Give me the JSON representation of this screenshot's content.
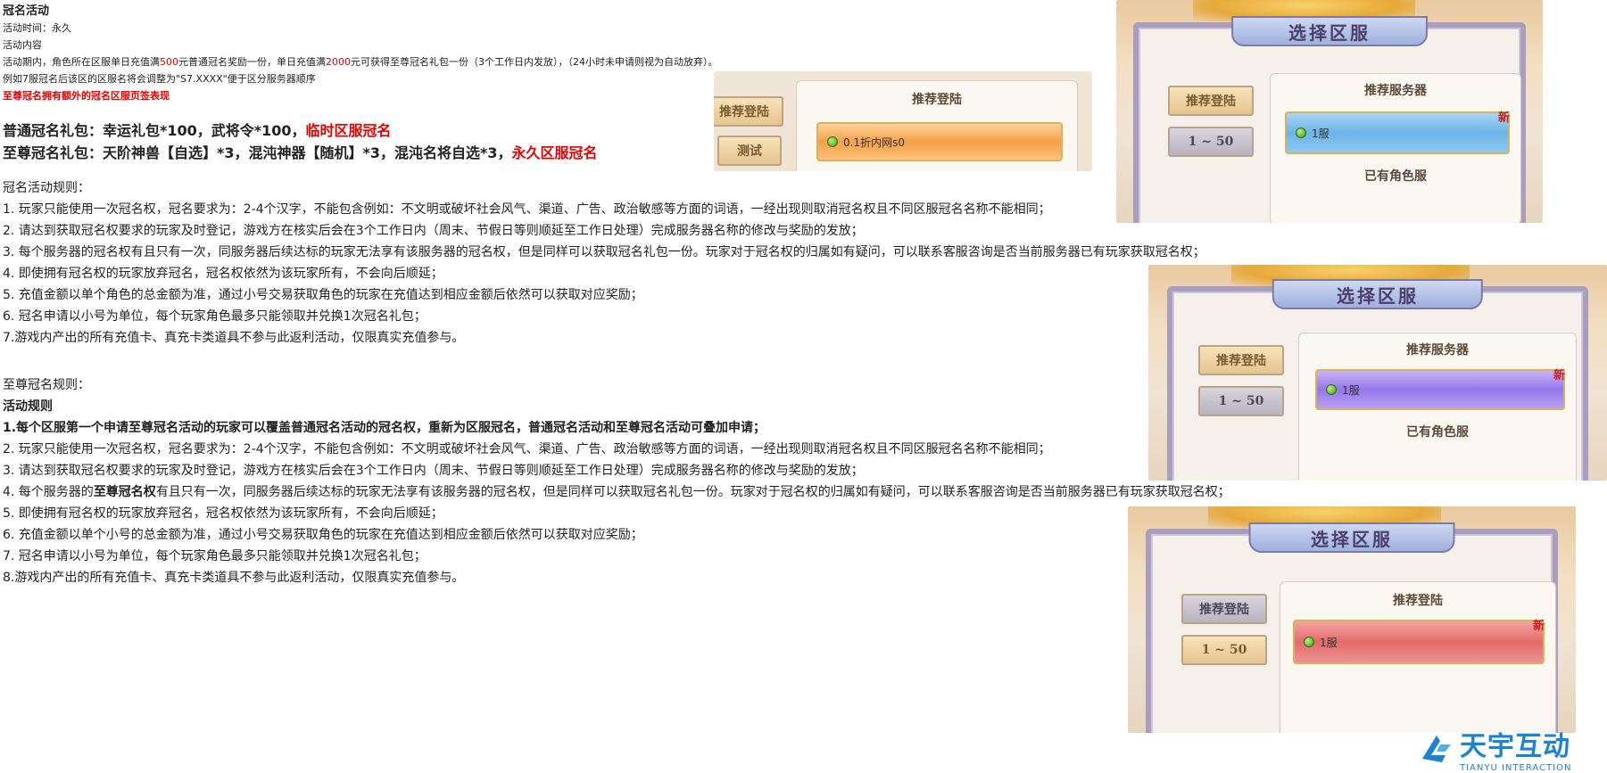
{
  "header": {
    "title": "冠名活动",
    "time_line": "活动时间：永久",
    "content_label": "活动内容",
    "desc_part1": "活动期内，角色所在区服单日充值满",
    "desc_amount1": "500",
    "desc_part2": "元普通冠名奖励一份，单日充值满",
    "desc_amount2": "2000",
    "desc_part3": "元可获得至尊冠名礼包一份（3个工作日内发放），（24小时未申请则视为自动放弃）。",
    "example_line": "例如7服冠名后该区的区服名将会调整为\"S7.XXXX\"便于区分服务器顺序",
    "note_red": "至尊冠名拥有额外的冠名区服页签表现"
  },
  "gifts": {
    "normal_text": "普通冠名礼包：幸运礼包*100，武将令*100，",
    "normal_red": "临时区服冠名",
    "supreme_text": "至尊冠名礼包：天阶神兽【自选】*3，混沌神器【随机】*3，混沌名将自选*3，",
    "supreme_red": "永久区服冠名"
  },
  "rules_normal": {
    "heading": "冠名活动规则：",
    "items": [
      "1. 玩家只能使用一次冠名权，冠名要求为：2-4个汉字，不能包含例如：不文明或破坏社会风气、渠道、广告、政治敏感等方面的词语，一经出现则取消冠名权且不同区服冠名名称不能相同；",
      "2. 请达到获取冠名权要求的玩家及时登记，游戏方在核实后会在3个工作日内（周末、节假日等则顺延至工作日处理）完成服务器名称的修改与奖励的发放；",
      "3. 每个服务器的冠名权有且只有一次，同服务器后续达标的玩家无法享有该服务器的冠名权，但是同样可以获取冠名礼包一份。玩家对于冠名权的归属如有疑问，可以联系客服咨询是否当前服务器已有玩家获取冠名权；",
      "4. 即使拥有冠名权的玩家放弃冠名，冠名权依然为该玩家所有，不会向后顺延；",
      "5. 充值金额以单个角色的总金额为准，通过小号交易获取角色的玩家在充值达到相应金额后依然可以获取对应奖励；",
      "6. 冠名申请以小号为单位，每个玩家角色最多只能领取并兑换1次冠名礼包；",
      "7.游戏内产出的所有充值卡、真充卡类道具不参与此返利活动，仅限真实充值参与。"
    ]
  },
  "rules_supreme": {
    "heading": "至尊冠名规则：",
    "sub": "活动规则",
    "item1": "1.每个区服第一个申请至尊冠名活动的玩家可以覆盖普通冠名活动的冠名权，重新为区服冠名，普通冠名活动和至尊冠名活动可叠加申请；",
    "item2": "2. 玩家只能使用一次冠名权，冠名要求为：2-4个汉字，不能包含例如：不文明或破坏社会风气、渠道、广告、政治敏感等方面的词语，一经出现则取消冠名权且不同区服冠名名称不能相同；",
    "item3": "3. 请达到获取冠名权要求的玩家及时登记，游戏方在核实后会在3个工作日内（周末、节假日等则顺延至工作日处理）完成服务器名称的修改与奖励的发放；",
    "item4_a": "4. 每个服务器的",
    "item4_bold": "至尊冠名权",
    "item4_b": "有且只有一次，同服务器后续达标的玩家无法享有该服务器的冠名权，但是同样可以获取冠名礼包一份。玩家对于冠名权的归属如有疑问，可以联系客服咨询是否当前服务器已有玩家获取冠名权；",
    "item5": "5. 即使拥有冠名权的玩家放弃冠名，冠名权依然为该玩家所有，不会向后顺延；",
    "item6": "6. 充值金额以单个小号的总金额为准，通过小号交易获取角色的玩家在充值达到相应金额后依然可以获取对应奖励；",
    "item7": "7. 冠名申请以小号为单位，每个玩家角色最多只能领取并兑换1次冠名礼包；",
    "item8": "8.游戏内产出的所有充值卡、真充卡类道具不参与此返利活动，仅限真实充值参与。"
  },
  "panel_small": {
    "left_btn1": "推荐登陆",
    "left_btn2": "测试",
    "section": "推荐登陆",
    "server": "0.1折内网s0"
  },
  "panel1": {
    "title": "选择区服",
    "btn_recommend": "推荐登陆",
    "btn_range": "1 ~ 50",
    "section_top": "推荐服务器",
    "server": "1服",
    "new_tag": "新",
    "section_bottom": "已有角色服"
  },
  "panel2": {
    "title": "选择区服",
    "btn_recommend": "推荐登陆",
    "btn_range": "1 ~ 50",
    "section_top": "推荐服务器",
    "server": "1服",
    "new_tag": "新",
    "section_bottom": "已有角色服"
  },
  "panel3": {
    "title": "选择区服",
    "btn_recommend": "推荐登陆",
    "btn_range": "1 ~ 50",
    "section_top": "推荐登陆",
    "server": "1服",
    "new_tag": "新"
  },
  "logo": {
    "main": "天宇互动",
    "sub": "TIANYU INTERACTION"
  }
}
